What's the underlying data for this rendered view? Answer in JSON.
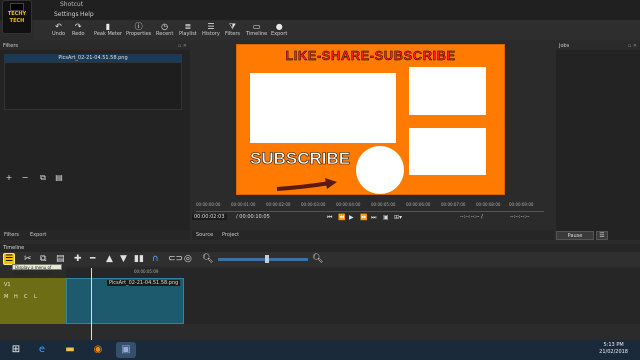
{
  "app": {
    "title": "Shotcut"
  },
  "logo": {
    "line1": "TECHY",
    "line2": "TECH"
  },
  "menu": [
    "Settings",
    "Help"
  ],
  "toolbar": [
    {
      "label": "Undo",
      "icon": "undo-icon",
      "glyph": "↶"
    },
    {
      "label": "Redo",
      "icon": "redo-icon",
      "glyph": "↷"
    },
    {
      "label": "Peak Meter",
      "icon": "peak-meter-icon",
      "glyph": "▮"
    },
    {
      "label": "Properties",
      "icon": "properties-icon",
      "glyph": "ⓘ"
    },
    {
      "label": "Recent",
      "icon": "recent-icon",
      "glyph": "◷"
    },
    {
      "label": "Playlist",
      "icon": "playlist-icon",
      "glyph": "≣"
    },
    {
      "label": "History",
      "icon": "history-icon",
      "glyph": "☰"
    },
    {
      "label": "Filters",
      "icon": "filters-icon",
      "glyph": "⧩"
    },
    {
      "label": "Timeline",
      "icon": "timeline-icon",
      "glyph": "▭"
    },
    {
      "label": "Export",
      "icon": "export-icon",
      "glyph": "●"
    }
  ],
  "filters_panel": {
    "title": "Filters",
    "file": "PicsArt_02-21-04.51.58.png"
  },
  "left_tabs": [
    "Filters",
    "Export"
  ],
  "video": {
    "banner": "LIKE-SHARE-SUBSCRIBE",
    "subscribe": "SUBSCRIBE",
    "background_color": "#ff7a00",
    "banner_color": "#ff1f1f"
  },
  "ruler_ticks": [
    "00:00:00:00",
    "00:00:01:00",
    "00:00:02:00",
    "00:00:03:00",
    "00:00:04:00",
    "00:00:05:00",
    "00:00:06:00",
    "00:00:07:00",
    "00:00:08:00",
    "00:00:09:00"
  ],
  "transport": {
    "current_time": "00:00:02:03",
    "duration": "/ 00:00:10:05",
    "in_point": "--:--:--:-- /",
    "out_point": "--:--:--:--"
  },
  "source_tabs": [
    "Source",
    "Project"
  ],
  "jobs": {
    "title": "Jobs",
    "pause_label": "Pause"
  },
  "timeline": {
    "title": "Timeline",
    "tooltip": "Display a menu of additional actions",
    "tick_label": "00:00:05:09",
    "track_name": "V1",
    "track_buttons": [
      "M",
      "H",
      "C",
      "L"
    ],
    "clip_label": "PicsArt_02-21-04.51.58.png"
  },
  "taskbar": {
    "time": "5:13 PM",
    "date": "21/02/2018"
  }
}
